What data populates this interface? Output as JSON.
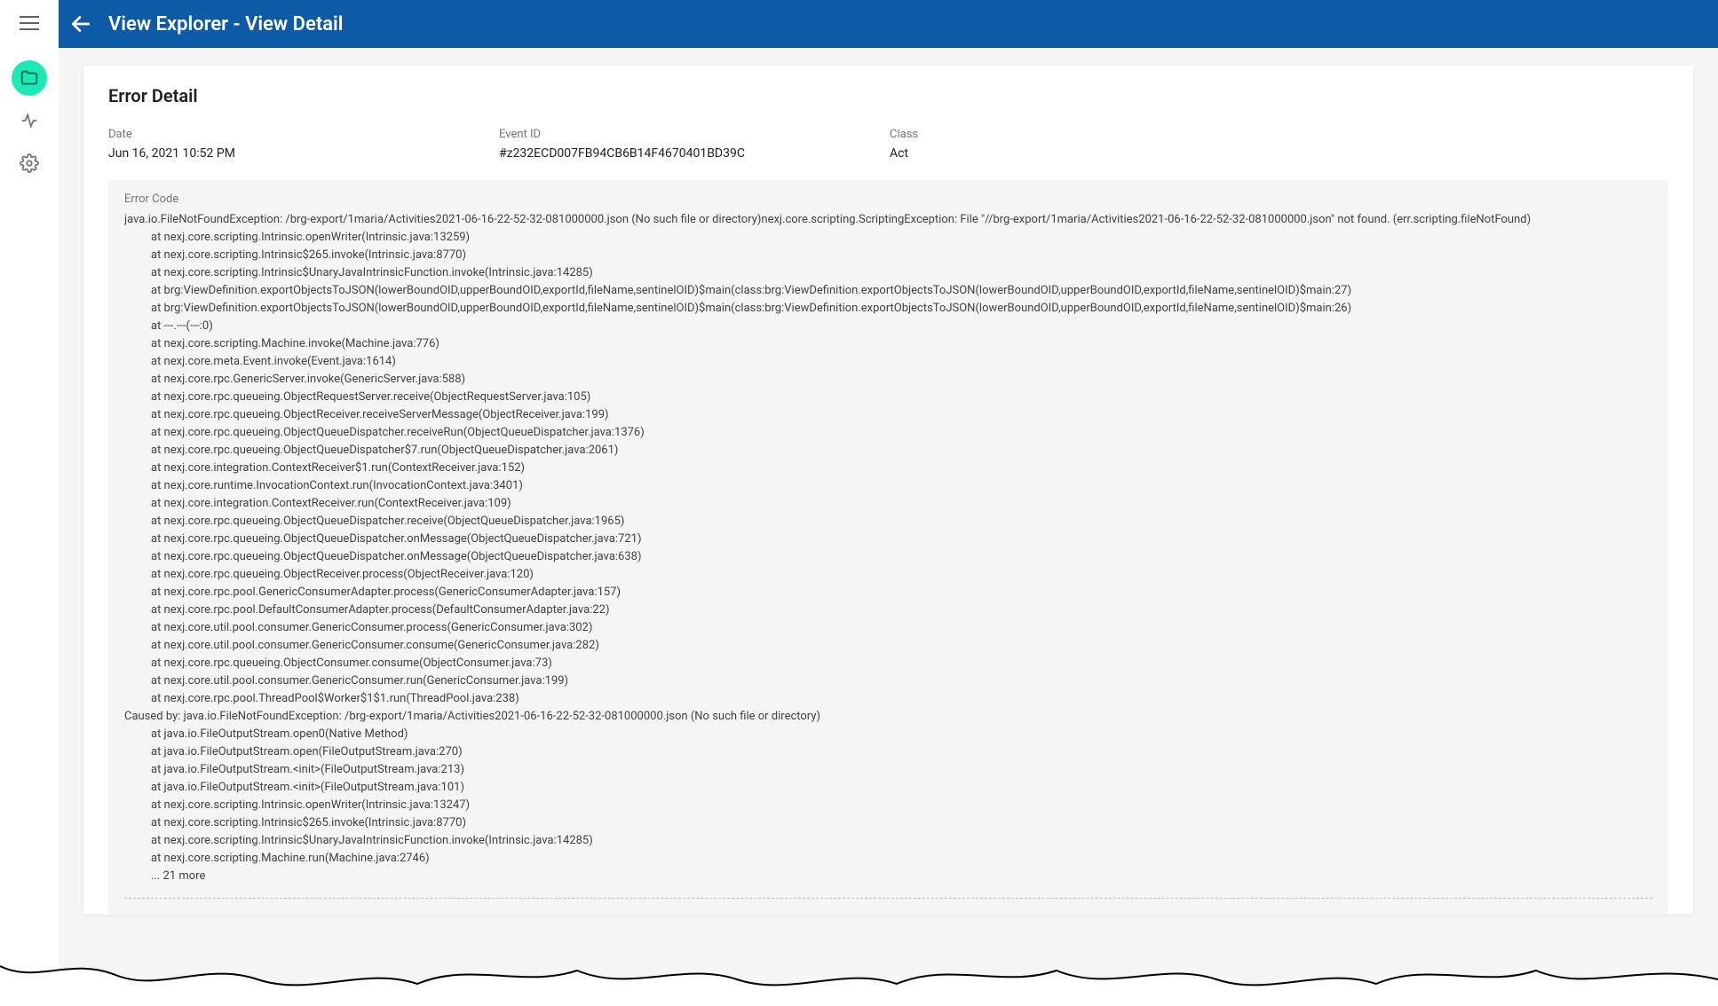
{
  "header": {
    "title": "View Explorer - View Detail"
  },
  "sidebar": {
    "items": [
      {
        "name": "folder",
        "active": true
      },
      {
        "name": "activity",
        "active": false
      },
      {
        "name": "settings",
        "active": false
      }
    ]
  },
  "card": {
    "title": "Error Detail",
    "fields": {
      "date_label": "Date",
      "date_value": "Jun 16, 2021 10:52 PM",
      "event_label": "Event ID",
      "event_value": "#z232ECD007FB94CB6B14F4670401BD39C",
      "class_label": "Class",
      "class_value": "Act"
    },
    "error_label": "Error Code",
    "stack": [
      {
        "t": "java.io.FileNotFoundException: /brg-export/1maria/Activities2021-06-16-22-52-32-081000000.json (No such file or directory)nexj.core.scripting.ScriptingException: File \"//brg-export/1maria/Activities2021-06-16-22-52-32-081000000.json\" not found. (err.scripting.fileNotFound)",
        "i": 0
      },
      {
        "t": "at nexj.core.scripting.Intrinsic.openWriter(Intrinsic.java:13259)",
        "i": 1
      },
      {
        "t": "at nexj.core.scripting.Intrinsic$265.invoke(Intrinsic.java:8770)",
        "i": 1
      },
      {
        "t": "at nexj.core.scripting.Intrinsic$UnaryJavaIntrinsicFunction.invoke(Intrinsic.java:14285)",
        "i": 1
      },
      {
        "t": "at brg:ViewDefinition.exportObjectsToJSON(lowerBoundOID,upperBoundOID,exportId,fileName,sentinelOID)$main(class:brg:ViewDefinition.exportObjectsToJSON(lowerBoundOID,upperBoundOID,exportId,fileName,sentinelOID)$main:27)",
        "i": 1
      },
      {
        "t": "at brg:ViewDefinition.exportObjectsToJSON(lowerBoundOID,upperBoundOID,exportId,fileName,sentinelOID)$main(class:brg:ViewDefinition.exportObjectsToJSON(lowerBoundOID,upperBoundOID,exportId,fileName,sentinelOID)$main:26)",
        "i": 1
      },
      {
        "t": "at ---.---(---:0)",
        "i": 1
      },
      {
        "t": "at nexj.core.scripting.Machine.invoke(Machine.java:776)",
        "i": 1
      },
      {
        "t": "at nexj.core.meta.Event.invoke(Event.java:1614)",
        "i": 1
      },
      {
        "t": "at nexj.core.rpc.GenericServer.invoke(GenericServer.java:588)",
        "i": 1
      },
      {
        "t": "at nexj.core.rpc.queueing.ObjectRequestServer.receive(ObjectRequestServer.java:105)",
        "i": 1
      },
      {
        "t": "at nexj.core.rpc.queueing.ObjectReceiver.receiveServerMessage(ObjectReceiver.java:199)",
        "i": 1
      },
      {
        "t": "at nexj.core.rpc.queueing.ObjectQueueDispatcher.receiveRun(ObjectQueueDispatcher.java:1376)",
        "i": 1
      },
      {
        "t": "at nexj.core.rpc.queueing.ObjectQueueDispatcher$7.run(ObjectQueueDispatcher.java:2061)",
        "i": 1
      },
      {
        "t": "at nexj.core.integration.ContextReceiver$1.run(ContextReceiver.java:152)",
        "i": 1
      },
      {
        "t": "at nexj.core.runtime.InvocationContext.run(InvocationContext.java:3401)",
        "i": 1
      },
      {
        "t": "at nexj.core.integration.ContextReceiver.run(ContextReceiver.java:109)",
        "i": 1
      },
      {
        "t": "at nexj.core.rpc.queueing.ObjectQueueDispatcher.receive(ObjectQueueDispatcher.java:1965)",
        "i": 1
      },
      {
        "t": "at nexj.core.rpc.queueing.ObjectQueueDispatcher.onMessage(ObjectQueueDispatcher.java:721)",
        "i": 1
      },
      {
        "t": "at nexj.core.rpc.queueing.ObjectQueueDispatcher.onMessage(ObjectQueueDispatcher.java:638)",
        "i": 1
      },
      {
        "t": "at nexj.core.rpc.queueing.ObjectReceiver.process(ObjectReceiver.java:120)",
        "i": 1
      },
      {
        "t": "at nexj.core.rpc.pool.GenericConsumerAdapter.process(GenericConsumerAdapter.java:157)",
        "i": 1
      },
      {
        "t": "at nexj.core.rpc.pool.DefaultConsumerAdapter.process(DefaultConsumerAdapter.java:22)",
        "i": 1
      },
      {
        "t": "at nexj.core.util.pool.consumer.GenericConsumer.process(GenericConsumer.java:302)",
        "i": 1
      },
      {
        "t": "at nexj.core.util.pool.consumer.GenericConsumer.consume(GenericConsumer.java:282)",
        "i": 1
      },
      {
        "t": "at nexj.core.rpc.queueing.ObjectConsumer.consume(ObjectConsumer.java:73)",
        "i": 1
      },
      {
        "t": "at nexj.core.util.pool.consumer.GenericConsumer.run(GenericConsumer.java:199)",
        "i": 1
      },
      {
        "t": "at nexj.core.rpc.pool.ThreadPool$Worker$1$1.run(ThreadPool.java:238)",
        "i": 1
      },
      {
        "t": "Caused by: java.io.FileNotFoundException: /brg-export/1maria/Activities2021-06-16-22-52-32-081000000.json (No such file or directory)",
        "i": 0
      },
      {
        "t": "at java.io.FileOutputStream.open0(Native Method)",
        "i": 1
      },
      {
        "t": "at java.io.FileOutputStream.open(FileOutputStream.java:270)",
        "i": 1
      },
      {
        "t": "at java.io.FileOutputStream.<init>(FileOutputStream.java:213)",
        "i": 1
      },
      {
        "t": "at java.io.FileOutputStream.<init>(FileOutputStream.java:101)",
        "i": 1
      },
      {
        "t": "at nexj.core.scripting.Intrinsic.openWriter(Intrinsic.java:13247)",
        "i": 1
      },
      {
        "t": "at nexj.core.scripting.Intrinsic$265.invoke(Intrinsic.java:8770)",
        "i": 1
      },
      {
        "t": "at nexj.core.scripting.Intrinsic$UnaryJavaIntrinsicFunction.invoke(Intrinsic.java:14285)",
        "i": 1
      },
      {
        "t": "at nexj.core.scripting.Machine.run(Machine.java:2746)",
        "i": 1
      },
      {
        "t": "... 21 more",
        "i": 1
      }
    ]
  }
}
